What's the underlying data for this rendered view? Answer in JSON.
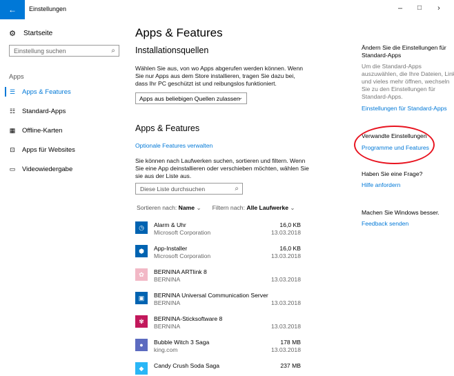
{
  "window": {
    "back_glyph": "←",
    "title": "Einstellungen",
    "minimize": "–",
    "maximize": "□",
    "close": "›"
  },
  "sidebar": {
    "home_label": "Startseite",
    "search_placeholder": "Einstellung suchen",
    "section_label": "Apps",
    "items": [
      {
        "label": "Apps & Features",
        "icon": "list-icon",
        "active": true
      },
      {
        "label": "Standard-Apps",
        "icon": "default-apps-icon",
        "active": false
      },
      {
        "label": "Offline-Karten",
        "icon": "map-icon",
        "active": false
      },
      {
        "label": "Apps für Websites",
        "icon": "websites-icon",
        "active": false
      },
      {
        "label": "Videowiedergabe",
        "icon": "video-icon",
        "active": false
      }
    ]
  },
  "main": {
    "title": "Apps & Features",
    "install_heading": "Installationsquellen",
    "install_text": "Wählen Sie aus, von wo Apps abgerufen werden können. Wenn Sie nur Apps aus dem Store installieren, tragen Sie dazu bei, dass Ihr PC geschützt ist und reibungslos funktioniert.",
    "install_dropdown": "Apps aus beliebigen Quellen zulassen",
    "features_heading": "Apps & Features",
    "optional_link": "Optionale Features verwalten",
    "features_text": "Sie können nach Laufwerken suchen, sortieren und filtern. Wenn Sie eine App deinstallieren oder verschieben möchten, wählen Sie sie aus der Liste aus.",
    "list_search_placeholder": "Diese Liste durchsuchen",
    "sort_label": "Sortieren nach:",
    "sort_value": "Name",
    "filter_label": "Filtern nach:",
    "filter_value": "Alle Laufwerke",
    "apps": [
      {
        "name": "Alarm & Uhr",
        "publisher": "Microsoft Corporation",
        "size": "16,0 KB",
        "date": "13.03.2018",
        "icon": "alarm-clock-icon",
        "color": "#0063b1"
      },
      {
        "name": "App-Installer",
        "publisher": "Microsoft Corporation",
        "size": "16,0 KB",
        "date": "13.03.2018",
        "icon": "package-icon",
        "color": "#0063b1"
      },
      {
        "name": "BERNINA ARTlink 8",
        "publisher": "BERNINA",
        "size": "",
        "date": "13.03.2018",
        "icon": "bernina-artlink-icon",
        "color": "#f2b8c6"
      },
      {
        "name": "BERNINA Universal Communication Server",
        "publisher": "BERNINA",
        "size": "",
        "date": "13.03.2018",
        "icon": "server-icon",
        "color": "#0063b1"
      },
      {
        "name": "BERNINA-Sticksoftware 8",
        "publisher": "BERNINA",
        "size": "",
        "date": "13.03.2018",
        "icon": "embroidery-icon",
        "color": "#c2185b"
      },
      {
        "name": "Bubble Witch 3 Saga",
        "publisher": "king.com",
        "size": "178 MB",
        "date": "13.03.2018",
        "icon": "bubble-witch-icon",
        "color": "#5c6bc0"
      },
      {
        "name": "Candy Crush Soda Saga",
        "publisher": "",
        "size": "237 MB",
        "date": "",
        "icon": "candy-crush-icon",
        "color": "#29b6f6"
      }
    ]
  },
  "right": {
    "change_text_lines": [
      "Ändern Sie die Einstellungen für",
      "Standard-Apps"
    ],
    "gray_lines": [
      "Um die Standard-Apps",
      "auszuwählen, die Ihre Dateien, Links",
      "und vieles mehr öffnen, wechseln",
      "Sie zu den Einstellungen für",
      "Standard-Apps."
    ],
    "default_apps_link": "Einstellungen für Standard-Apps",
    "related_heading": "Verwandte Einstellungen",
    "programs_link": "Programme und Features",
    "question_heading": "Haben Sie eine Frage?",
    "help_link": "Hilfe anfordern",
    "improve_heading": "Machen Sie Windows besser.",
    "feedback_link": "Feedback senden"
  },
  "colors": {
    "accent": "#0078d7",
    "highlight_oval": "#e8131f"
  }
}
